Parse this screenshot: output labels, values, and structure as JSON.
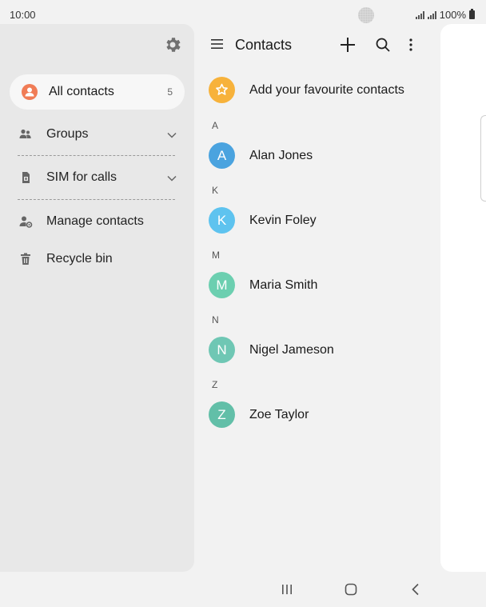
{
  "status": {
    "time": "10:00",
    "battery": "100%"
  },
  "drawer": {
    "settings_icon": "gear-icon",
    "all_contacts": {
      "label": "All contacts",
      "count": "5"
    },
    "items": [
      {
        "label": "Groups",
        "icon": "groups-icon",
        "expandable": true
      },
      {
        "label": "SIM for calls",
        "icon": "sim-icon",
        "expandable": true
      },
      {
        "label": "Manage contacts",
        "icon": "manage-contacts-icon",
        "expandable": false
      },
      {
        "label": "Recycle bin",
        "icon": "trash-icon",
        "expandable": false
      }
    ]
  },
  "header": {
    "title": "Contacts",
    "icons": [
      "menu-icon",
      "add-icon",
      "search-icon",
      "more-icon"
    ]
  },
  "favourites": {
    "label": "Add your favourite contacts",
    "icon": "star-icon"
  },
  "sections": [
    {
      "letter": "A",
      "contacts": [
        {
          "name": "Alan Jones",
          "initial": "A",
          "color": "#4aa3df"
        }
      ]
    },
    {
      "letter": "K",
      "contacts": [
        {
          "name": "Kevin Foley",
          "initial": "K",
          "color": "#5ec3ef"
        }
      ]
    },
    {
      "letter": "M",
      "contacts": [
        {
          "name": "Maria Smith",
          "initial": "M",
          "color": "#6ccfb0"
        }
      ]
    },
    {
      "letter": "N",
      "contacts": [
        {
          "name": "Nigel Jameson",
          "initial": "N",
          "color": "#6fc7b4"
        }
      ]
    },
    {
      "letter": "Z",
      "contacts": [
        {
          "name": "Zoe Taylor",
          "initial": "Z",
          "color": "#62bfa8"
        }
      ]
    }
  ],
  "nav": {
    "icons": [
      "recent-apps-icon",
      "home-icon",
      "back-icon"
    ]
  }
}
